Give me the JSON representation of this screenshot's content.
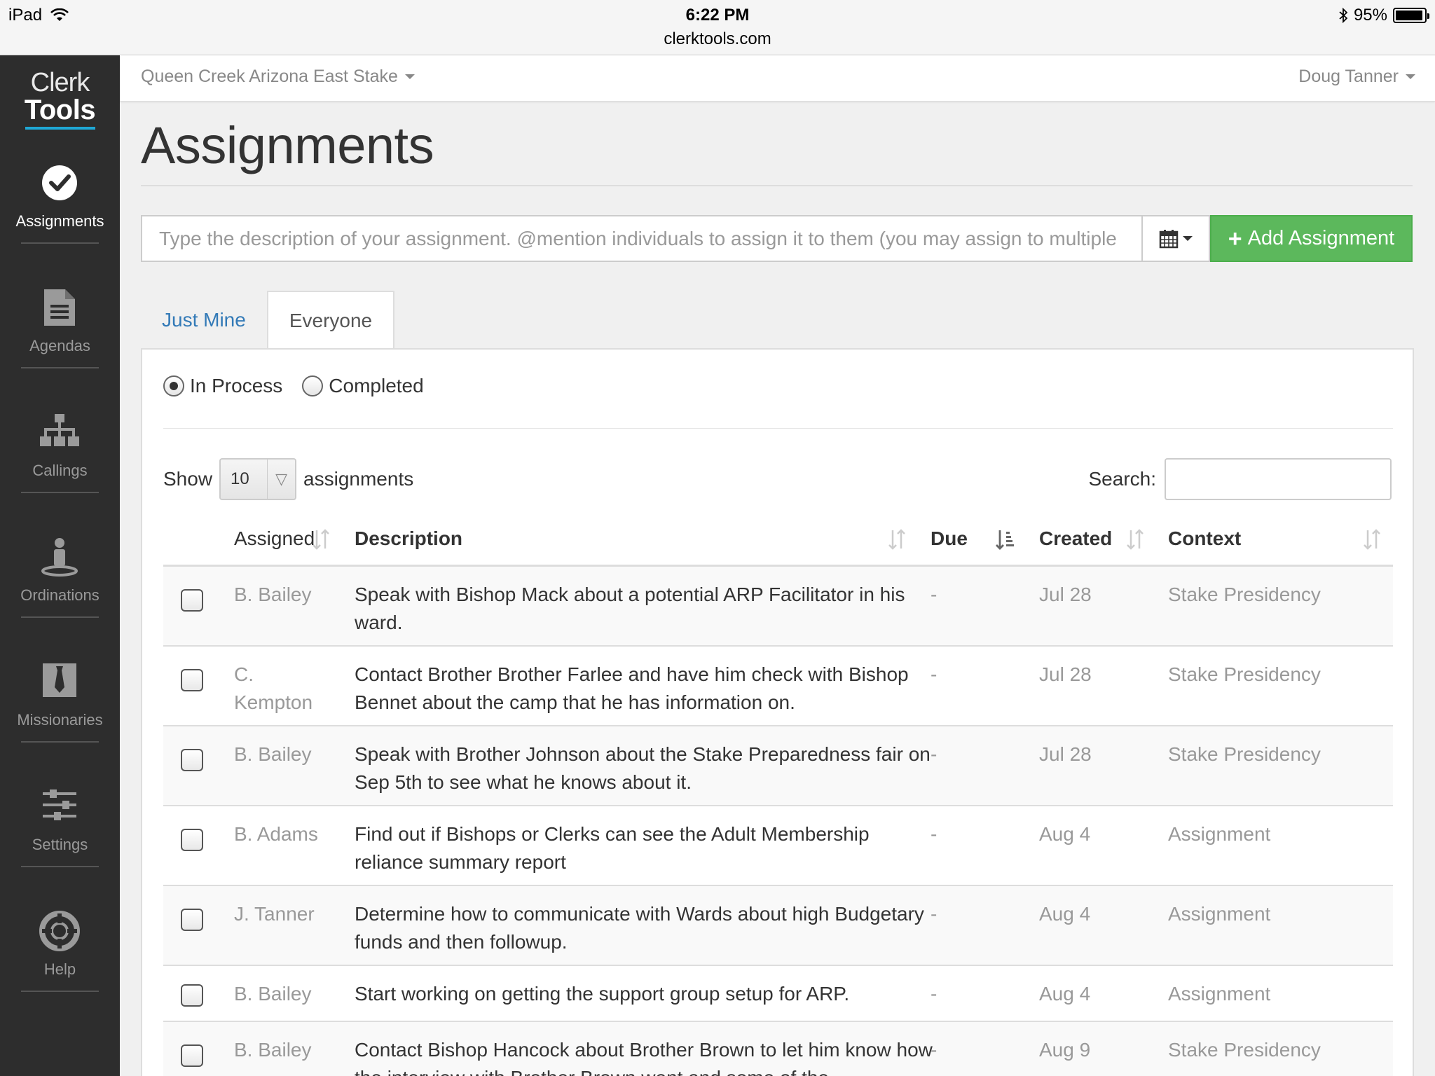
{
  "statusbar": {
    "device": "iPad",
    "time": "6:22 PM",
    "url": "clerktools.com",
    "battery": "95%",
    "battery_level": 0.95
  },
  "sidebar": {
    "logo_line1": "Clerk",
    "logo_line2": "Tools",
    "accent": "#1fa8d6",
    "items": [
      {
        "label": "Assignments",
        "icon": "check-circle-icon",
        "active": true
      },
      {
        "label": "Agendas",
        "icon": "document-icon"
      },
      {
        "label": "Callings",
        "icon": "org-chart-icon"
      },
      {
        "label": "Ordinations",
        "icon": "person-icon"
      },
      {
        "label": "Missionaries",
        "icon": "missionary-tie-icon"
      },
      {
        "label": "Settings",
        "icon": "sliders-icon"
      },
      {
        "label": "Help",
        "icon": "lifebuoy-icon"
      }
    ]
  },
  "topbar": {
    "stake": "Queen Creek Arizona East Stake",
    "user": "Doug Tanner"
  },
  "page": {
    "title": "Assignments",
    "add_placeholder": "Type the description of your assignment. @mention individuals to assign it to them (you may assign to multiple",
    "add_button": "Add Assignment",
    "add_button_color": "#5cb85c"
  },
  "tabs": [
    {
      "label": "Just Mine",
      "active": false
    },
    {
      "label": "Everyone",
      "active": true
    }
  ],
  "filters": {
    "in_process": "In Process",
    "completed": "Completed",
    "selected": "in_process"
  },
  "listing": {
    "show_label": "Show",
    "show_value": "10",
    "show_suffix": "assignments",
    "search_label": "Search:"
  },
  "table": {
    "headers": {
      "assigned": "Assigned",
      "description": "Description",
      "due": "Due",
      "created": "Created",
      "context": "Context"
    },
    "rows": [
      {
        "assigned": "B. Bailey",
        "description": "Speak with Bishop Mack about a potential ARP Facilitator in his ward.",
        "due": "-",
        "created": "Jul 28",
        "context": "Stake Presidency"
      },
      {
        "assigned": "C. Kempton",
        "description": "Contact Brother Brother Farlee and have him check with Bishop Bennet about the camp that he has information on.",
        "due": "-",
        "created": "Jul 28",
        "context": "Stake Presidency"
      },
      {
        "assigned": "B. Bailey",
        "description": "Speak with Brother Johnson about the Stake Preparedness fair on Sep 5th to see what he knows about it.",
        "due": "-",
        "created": "Jul 28",
        "context": "Stake Presidency"
      },
      {
        "assigned": "B. Adams",
        "description": "Find out if Bishops or Clerks can see the Adult Membership reliance summary report",
        "due": "-",
        "created": "Aug 4",
        "context": "Assignment"
      },
      {
        "assigned": "J. Tanner",
        "description": "Determine how to communicate with Wards about high Budgetary funds and then followup.",
        "due": "-",
        "created": "Aug 4",
        "context": "Assignment"
      },
      {
        "assigned": "B. Bailey",
        "description": "Start working on getting the support group setup for ARP.",
        "due": "-",
        "created": "Aug 4",
        "context": "Assignment"
      },
      {
        "assigned": "B. Bailey",
        "description": "Contact Bishop Hancock about Brother Brown to let him know how the interview with Brother Brown went and some of the",
        "due": "-",
        "created": "Aug 9",
        "context": "Stake Presidency"
      }
    ]
  }
}
